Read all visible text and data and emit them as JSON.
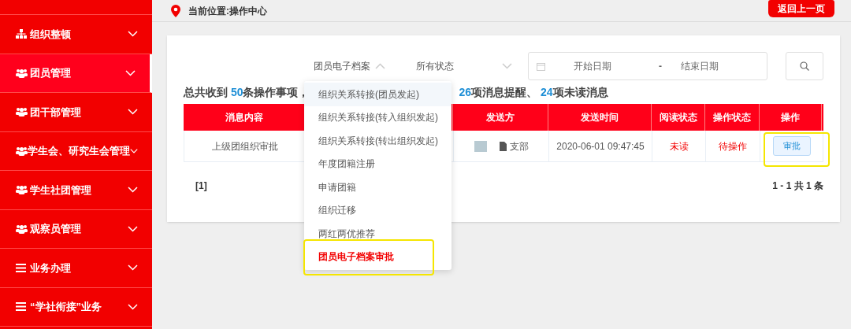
{
  "sidebar": {
    "items": [
      {
        "label": "组织整顿",
        "kind": "tree",
        "selected": false
      },
      {
        "label": "团员管理",
        "kind": "users",
        "selected": true
      },
      {
        "label": "团干部管理",
        "kind": "users",
        "selected": false
      },
      {
        "label": "学生会、研究生会管理",
        "kind": "users",
        "selected": false
      },
      {
        "label": "学生社团管理",
        "kind": "users",
        "selected": false
      },
      {
        "label": "观察员管理",
        "kind": "users",
        "selected": false
      },
      {
        "label": "业务办理",
        "kind": "bars",
        "selected": false
      },
      {
        "label": "“学社衔接”业务",
        "kind": "bars",
        "selected": false
      }
    ]
  },
  "breadcrumb": "当前位置:操作中心",
  "back_button": "返回上一页",
  "filters": {
    "category": {
      "value": "团员电子档案",
      "expanded": true
    },
    "status": {
      "value": "所有状态",
      "expanded": false
    },
    "date_range": {
      "start_placeholder": "开始日期",
      "separator": "-",
      "end_placeholder": "结束日期"
    }
  },
  "dropdown": {
    "items": [
      {
        "label": "组织关系转接(团员发起)",
        "selected": false,
        "highlighted": true,
        "annotated": false
      },
      {
        "label": "组织关系转接(转入组织发起)",
        "selected": false,
        "highlighted": false,
        "annotated": false
      },
      {
        "label": "组织关系转接(转出组织发起)",
        "selected": false,
        "highlighted": false,
        "annotated": false
      },
      {
        "label": "年度团籍注册",
        "selected": false,
        "highlighted": false,
        "annotated": false
      },
      {
        "label": "申请团籍",
        "selected": false,
        "highlighted": false,
        "annotated": false
      },
      {
        "label": "组织迁移",
        "selected": false,
        "highlighted": false,
        "annotated": false
      },
      {
        "label": "两红两优推荐",
        "selected": false,
        "highlighted": false,
        "annotated": false
      },
      {
        "label": "团员电子档案审批",
        "selected": true,
        "highlighted": false,
        "annotated": true
      }
    ]
  },
  "summary_start": [
    {
      "text": "总共收到 ",
      "number": false
    },
    {
      "text": "50",
      "number": true
    },
    {
      "text": "条操作事项，",
      "number": false
    }
  ],
  "summary_end": [
    {
      "text": "26",
      "number": true
    },
    {
      "text": "项消息提醒、 ",
      "number": false
    },
    {
      "text": "24",
      "number": true
    },
    {
      "text": "项未读消息",
      "number": false
    }
  ],
  "table": {
    "columns": [
      {
        "label": "消息内容"
      },
      {},
      {
        "label": "发送方"
      },
      {
        "label": "发送时间"
      },
      {
        "label": "阅读状态"
      },
      {
        "label": "操作状态"
      },
      {
        "label": "操作"
      }
    ],
    "rows": [
      {
        "content": "上级团组织审批",
        "sender": "支部",
        "time": "2020-06-01 09:47:45",
        "read_status": "未读",
        "op_status": "待操作",
        "action": "审批",
        "action_annotated": true
      }
    ]
  },
  "pagination": {
    "pages": "[1]",
    "range": "1 - 1 共 1 条"
  }
}
